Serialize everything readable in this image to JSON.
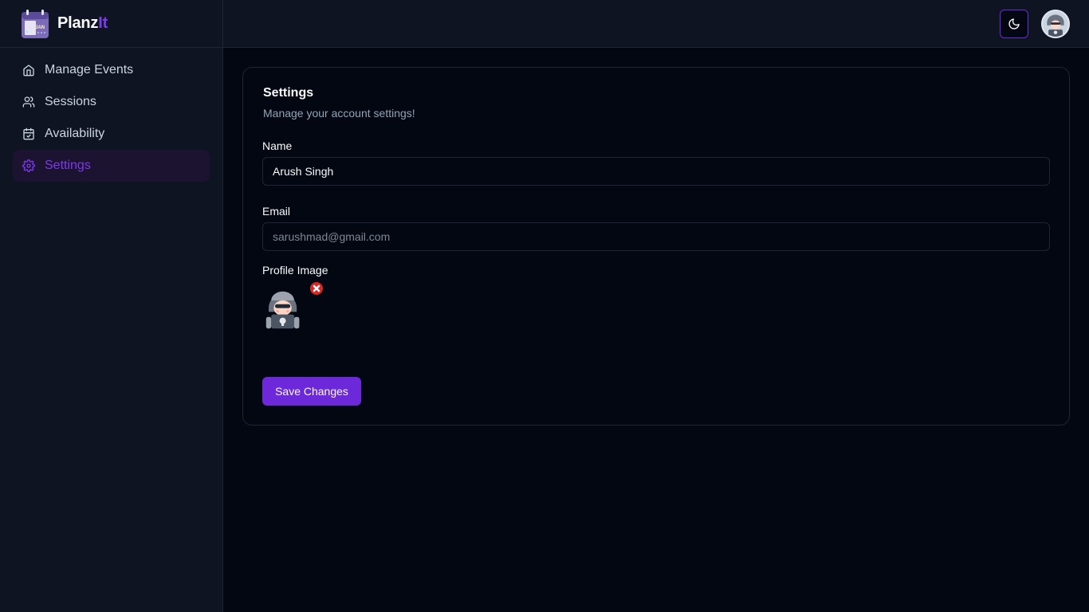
{
  "brand": {
    "name_main": "Planz",
    "name_accent": "It",
    "accent_color": "#7c3aed"
  },
  "sidebar": {
    "items": [
      {
        "label": "Manage Events",
        "icon": "home-icon"
      },
      {
        "label": "Sessions",
        "icon": "users-icon"
      },
      {
        "label": "Availability",
        "icon": "calendar-check-icon"
      },
      {
        "label": "Settings",
        "icon": "gear-icon",
        "active": true
      }
    ]
  },
  "header": {
    "theme_toggle_icon": "moon-icon",
    "avatar_icon": "hacker-avatar-icon"
  },
  "settings": {
    "title": "Settings",
    "subtitle": "Manage your account settings!",
    "name_label": "Name",
    "name_value": "Arush Singh",
    "email_label": "Email",
    "email_value": "sarushmad@gmail.com",
    "profile_image_label": "Profile Image",
    "remove_icon": "close-circle-icon",
    "save_label": "Save Changes"
  }
}
